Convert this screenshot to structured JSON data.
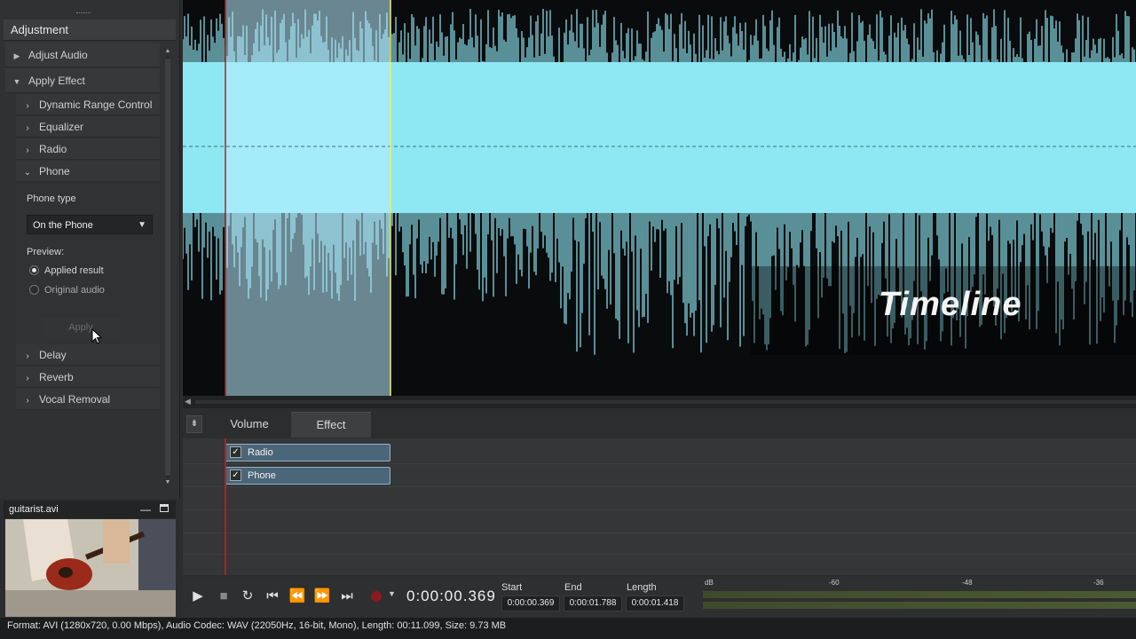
{
  "adjustment": {
    "title": "Adjustment",
    "adjust_audio": "Adjust Audio",
    "apply_effect": "Apply Effect",
    "effects": [
      "Dynamic Range Control",
      "Equalizer",
      "Radio",
      "Phone"
    ],
    "phone_type_label": "Phone type",
    "phone_type_value": "On the Phone",
    "preview_label": "Preview:",
    "preview_options": [
      "Applied result",
      "Original audio"
    ],
    "apply_label": "Apply",
    "more_effects": [
      "Delay",
      "Reverb",
      "Vocal Removal"
    ]
  },
  "video": {
    "filename": "guitarist.avi"
  },
  "waveform": {
    "overlay_text": "Timeline"
  },
  "tabs": [
    "Volume",
    "Effect"
  ],
  "tracks": {
    "items": [
      "Radio",
      "Phone"
    ]
  },
  "transport": {
    "timecode": "0:00:00.369",
    "start_label": "Start",
    "start_value": "0:00:00.369",
    "end_label": "End",
    "end_value": "0:00:01.788",
    "length_label": "Length",
    "length_value": "0:00:01.418"
  },
  "meter": {
    "labels": [
      "dB",
      "-60",
      "-48",
      "-36"
    ]
  },
  "status": "Format: AVI (1280x720, 0.00 Mbps), Audio Codec: WAV (22050Hz, 16-bit, Mono), Length: 00:11.099, Size: 9.73 MB",
  "colors": {
    "waveform": "#8ee8f4",
    "selection": "#b8ecff",
    "playhead": "#b22222",
    "selection_end": "#f0f060"
  }
}
